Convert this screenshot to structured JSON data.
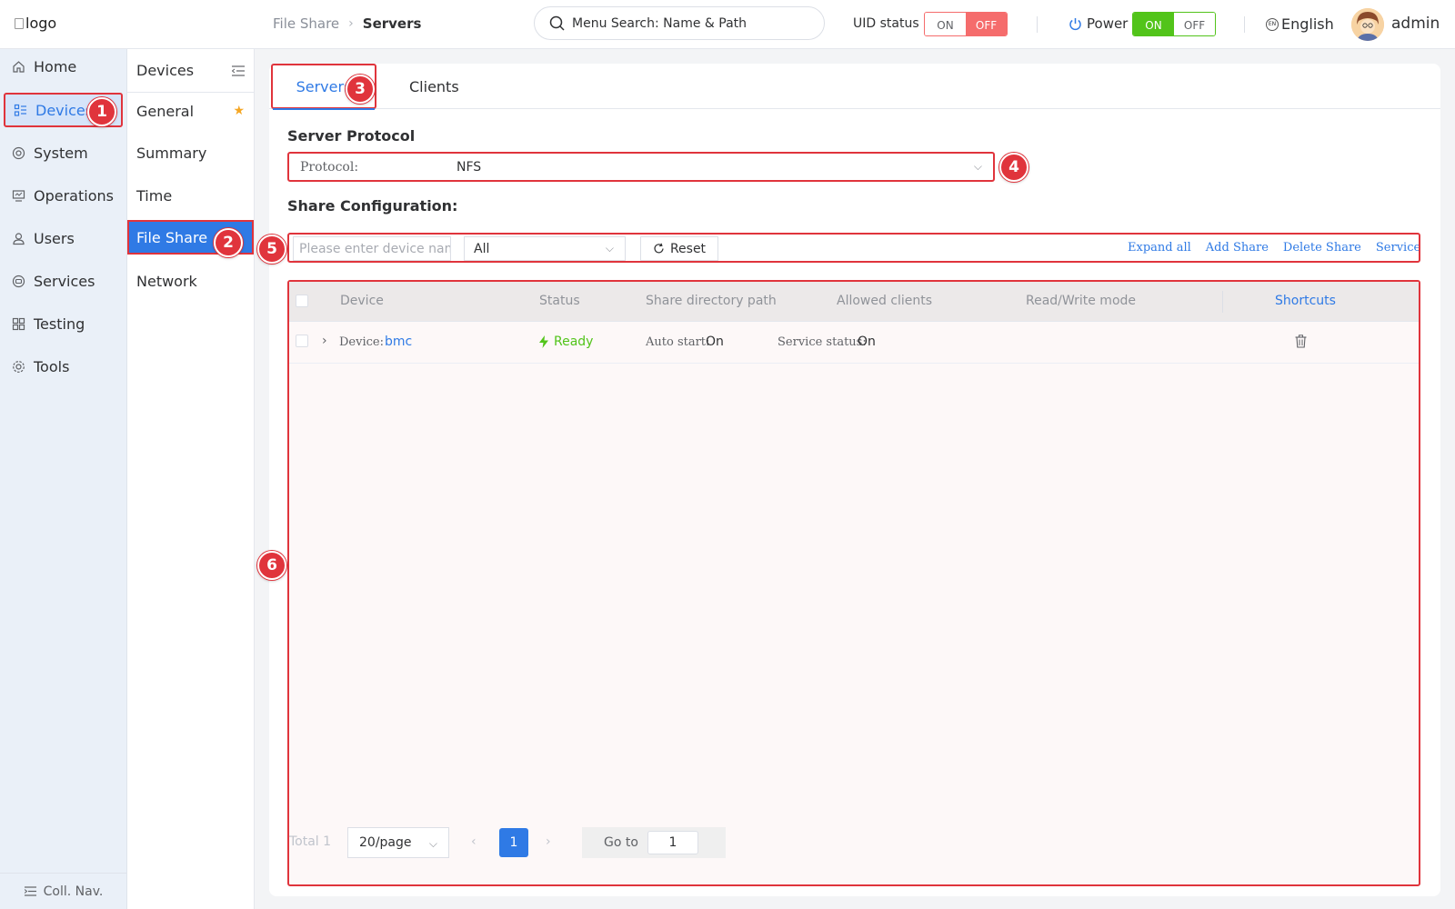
{
  "header": {
    "logo_alt": "logo",
    "breadcrumb": [
      "File Share",
      "Servers"
    ],
    "search_placeholder": "Menu Search: Name & Path",
    "uid_label": "UID status",
    "uid_on": "ON",
    "uid_off": "OFF",
    "power_label": "Power",
    "power_on": "ON",
    "power_off": "OFF",
    "language": "English",
    "language_badge": "EN",
    "user": "admin"
  },
  "nav": {
    "items": [
      {
        "label": "Home",
        "icon": "home-icon"
      },
      {
        "label": "Devices",
        "icon": "devices-icon"
      },
      {
        "label": "System",
        "icon": "system-icon"
      },
      {
        "label": "Operations",
        "icon": "operations-icon"
      },
      {
        "label": "Users",
        "icon": "users-icon"
      },
      {
        "label": "Services",
        "icon": "services-icon"
      },
      {
        "label": "Testing",
        "icon": "testing-icon"
      },
      {
        "label": "Tools",
        "icon": "tools-icon"
      }
    ],
    "active": "Devices",
    "collapse_label": "Coll. Nav."
  },
  "subnav": {
    "title": "Devices",
    "items": [
      "General",
      "Summary",
      "Time",
      "File Share",
      "Network"
    ],
    "active": "File Share"
  },
  "tabs": [
    "Servers",
    "Clients"
  ],
  "server_protocol": {
    "title": "Server Protocol",
    "label": "Protocol:",
    "value": "NFS"
  },
  "share_config": {
    "title": "Share Configuration:",
    "input_placeholder": "Please enter device name",
    "select_value": "All",
    "reset": "Reset",
    "links": [
      "Expand all",
      "Add Share",
      "Delete Share",
      "Service Setting"
    ]
  },
  "table": {
    "columns": [
      "Device",
      "Status",
      "Share directory path",
      "Allowed clients",
      "Read/Write mode",
      "Shortcuts"
    ],
    "rows": [
      {
        "device_label": "Device:",
        "device": "bmc",
        "status": "Ready",
        "auto_start_label": "Auto start:",
        "auto_start": "On",
        "service_status_label": "Service status:",
        "service_status": "On"
      }
    ]
  },
  "pagination": {
    "total": "Total 1",
    "page_size": "20/page",
    "current_page": "1",
    "goto_label": "Go to",
    "goto_value": "1"
  },
  "callouts": [
    "1",
    "2",
    "3",
    "4",
    "5",
    "6"
  ],
  "colors": {
    "accent": "#2f7ae5",
    "highlight": "#e0343c",
    "success": "#52c41a",
    "danger": "#f56c6c"
  }
}
